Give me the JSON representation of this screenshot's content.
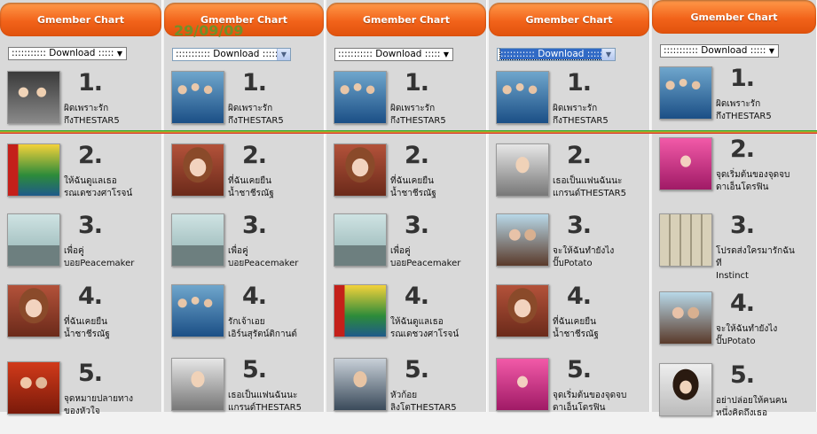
{
  "chart_title": "Gmember Chart",
  "date": "29/09/09",
  "download_label": "::::::::::: Download :::::",
  "columns": [
    {
      "header": "Gmember Chart",
      "dropdown": "::::::::::: Download :::::",
      "items": [
        {
          "rank": "1.",
          "title": [
            "ผิดเพราะรัก",
            "กึงTHESTAR5"
          ],
          "art": "t-group2",
          "icon": "album-cover"
        },
        {
          "rank": "2.",
          "title": [
            "ให้ฉันดูแลเธอ",
            "รณเดชวงศาโรจน์"
          ],
          "art": "t-comp",
          "icon": "album-cover"
        },
        {
          "rank": "3.",
          "title": [
            "เพื่อคู่",
            "บอยPeacemaker"
          ],
          "art": "t-city",
          "icon": "album-cover"
        },
        {
          "rank": "4.",
          "title": [
            "ที่ฉันเคยยืน",
            "น้ำชาชีรณัฐ"
          ],
          "art": "t-girl",
          "icon": "album-cover"
        },
        {
          "rank": "5.",
          "title": [
            "จุดหมายปลายทาง",
            "ของหัวใจ"
          ],
          "art": "t-red",
          "icon": "album-cover"
        }
      ]
    },
    {
      "header": "Gmember Chart",
      "dropdown": "::::::::::: Download :::::",
      "items": [
        {
          "rank": "1.",
          "title": [
            "ผิดเพราะรัก",
            "กึงTHESTAR5"
          ],
          "art": "t-group",
          "icon": "album-cover"
        },
        {
          "rank": "2.",
          "title": [
            "ที่ฉันเคยยืน",
            "น้ำชาชีรณัฐ"
          ],
          "art": "t-girl",
          "icon": "album-cover"
        },
        {
          "rank": "3.",
          "title": [
            "เพื่อคู่",
            "บอยPeacemaker"
          ],
          "art": "t-city",
          "icon": "album-cover"
        },
        {
          "rank": "4.",
          "title": [
            "รักเจ้าเอย",
            "เอิร์นสุรัตน์ติกานต์"
          ],
          "art": "t-group",
          "icon": "album-cover"
        },
        {
          "rank": "5.",
          "title": [
            "เธอเป็นแฟนฉันนะ",
            "แกรนด์THESTAR5"
          ],
          "art": "t-dark",
          "icon": "album-cover"
        }
      ]
    },
    {
      "header": "Gmember Chart",
      "dropdown": "::::::::::: Download :::::",
      "items": [
        {
          "rank": "1.",
          "title": [
            "ผิดเพราะรัก",
            "กึงTHESTAR5"
          ],
          "art": "t-group",
          "icon": "album-cover"
        },
        {
          "rank": "2.",
          "title": [
            "ที่ฉันเคยยืน",
            "น้ำชาชีรณัฐ"
          ],
          "art": "t-girl",
          "icon": "album-cover"
        },
        {
          "rank": "3.",
          "title": [
            "เพื่อคู่",
            "บอยPeacemaker"
          ],
          "art": "t-city",
          "icon": "album-cover"
        },
        {
          "rank": "4.",
          "title": [
            "ให้ฉันดูแลเธอ",
            "รณเดชวงศาโรจน์"
          ],
          "art": "t-comp",
          "icon": "album-cover"
        },
        {
          "rank": "5.",
          "title": [
            "หัวก้อย",
            "ลิงโตTHESTAR5"
          ],
          "art": "t-guy",
          "icon": "album-cover"
        }
      ]
    },
    {
      "header": "Gmember Chart",
      "dropdown": "::::::::::: Download :::::",
      "items": [
        {
          "rank": "1.",
          "title": [
            "ผิดเพราะรัก",
            "กึงTHESTAR5"
          ],
          "art": "t-group",
          "icon": "album-cover"
        },
        {
          "rank": "2.",
          "title": [
            "เธอเป็นแฟนฉันนะ",
            "แกรนด์THESTAR5"
          ],
          "art": "t-dark",
          "icon": "album-cover"
        },
        {
          "rank": "3.",
          "title": [
            "จะให้ฉันทำยังไง",
            "ปั๊บPotato"
          ],
          "art": "t-couple",
          "icon": "album-cover"
        },
        {
          "rank": "4.",
          "title": [
            "ที่ฉันเคยยืน",
            "น้ำชาชีรณัฐ"
          ],
          "art": "t-girl",
          "icon": "album-cover"
        },
        {
          "rank": "5.",
          "title": [
            "จุดเริ่มต้นของจุดจบ",
            "ดาเอ็นโดรฟิน"
          ],
          "art": "t-pink",
          "icon": "album-cover"
        }
      ]
    },
    {
      "header": "Gmember Chart",
      "dropdown": "::::::::::: Download :::::",
      "items": [
        {
          "rank": "1.",
          "title": [
            "ผิดเพราะรัก",
            "กึงTHESTAR5"
          ],
          "art": "t-group",
          "icon": "album-cover"
        },
        {
          "rank": "2.",
          "title": [
            "จุดเริ่มต้นของจุดจบ",
            "ดาเอ็นโดรฟิน"
          ],
          "art": "t-pink",
          "icon": "album-cover"
        },
        {
          "rank": "3.",
          "title": [
            "โปรดส่งใครมารักฉัน",
            "ที",
            "Instinct"
          ],
          "art": "t-subway",
          "icon": "album-cover"
        },
        {
          "rank": "4.",
          "title": [
            "จะให้ฉันทำยังไง",
            "ปั๊บPotato"
          ],
          "art": "t-couple",
          "icon": "album-cover"
        },
        {
          "rank": "5.",
          "title": [
            "อย่าปล่อยให้คนคน",
            "หนึ่งคิดถึงเธอ"
          ],
          "art": "t-woman",
          "icon": "album-cover"
        }
      ]
    }
  ]
}
